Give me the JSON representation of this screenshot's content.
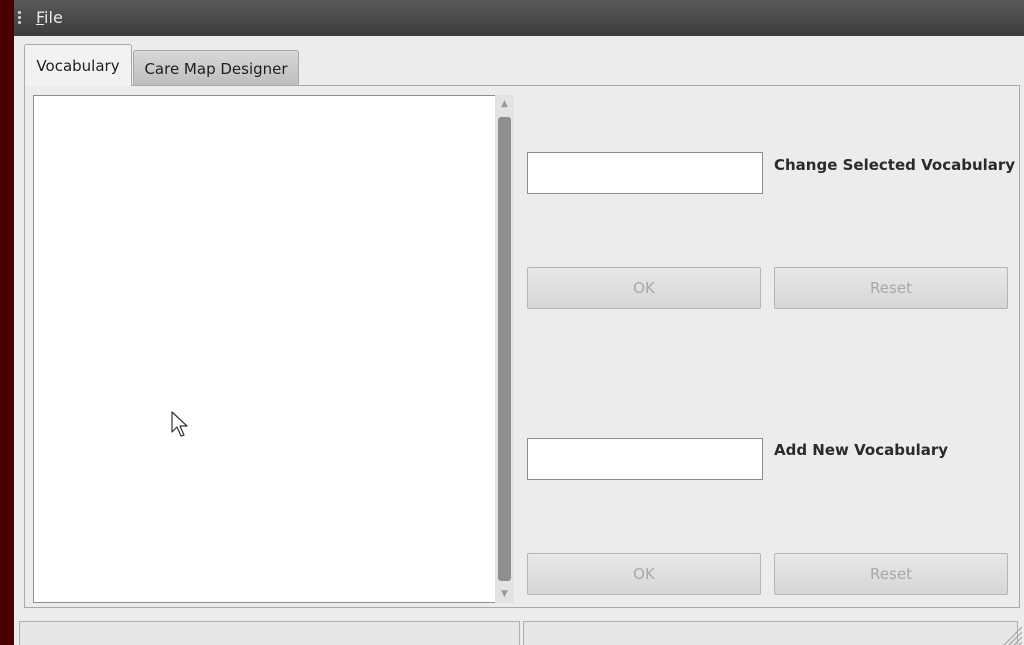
{
  "menubar": {
    "file_mnemonic": "F",
    "file_rest": "ile"
  },
  "tabs": [
    {
      "label": "Vocabulary",
      "active": true
    },
    {
      "label": "Care Map Designer",
      "active": false
    }
  ],
  "vocabulary_list": {
    "items": []
  },
  "change_section": {
    "input_value": "",
    "label": "Change Selected Vocabulary",
    "ok_label": "OK",
    "reset_label": "Reset"
  },
  "add_section": {
    "input_value": "",
    "label": "Add New Vocabulary",
    "ok_label": "OK",
    "reset_label": "Reset"
  },
  "status_bar": {
    "left_text": "",
    "right_text": ""
  },
  "colors": {
    "desktop_background": "#4a0000",
    "menubar": "#4a4a4a",
    "window_background": "#ececec",
    "disabled_text": "#a8a8a8"
  }
}
